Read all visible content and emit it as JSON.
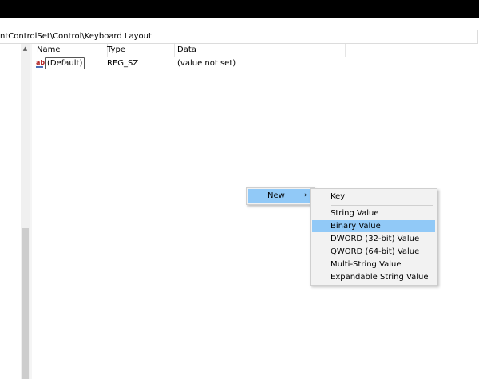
{
  "address": {
    "path": "ntControlSet\\Control\\Keyboard Layout"
  },
  "columns": {
    "name": "Name",
    "type": "Type",
    "data": "Data"
  },
  "values": [
    {
      "icon": "string-value-icon",
      "icon_text": "ab",
      "name": "(Default)",
      "type": "REG_SZ",
      "data": "(value not set)"
    }
  ],
  "context_menu": {
    "new_label": "New",
    "arrow": "›",
    "submenu": {
      "key": "Key",
      "string_value": "String Value",
      "binary_value": "Binary Value",
      "dword_value": "DWORD (32-bit) Value",
      "qword_value": "QWORD (64-bit) Value",
      "multi_string_value": "Multi-String Value",
      "expandable_string_value": "Expandable String Value",
      "highlighted": "Binary Value"
    }
  },
  "colors": {
    "highlight": "#91c9f7",
    "titlebar": "#000000"
  },
  "scrollbar": {
    "arrow": "▲"
  }
}
